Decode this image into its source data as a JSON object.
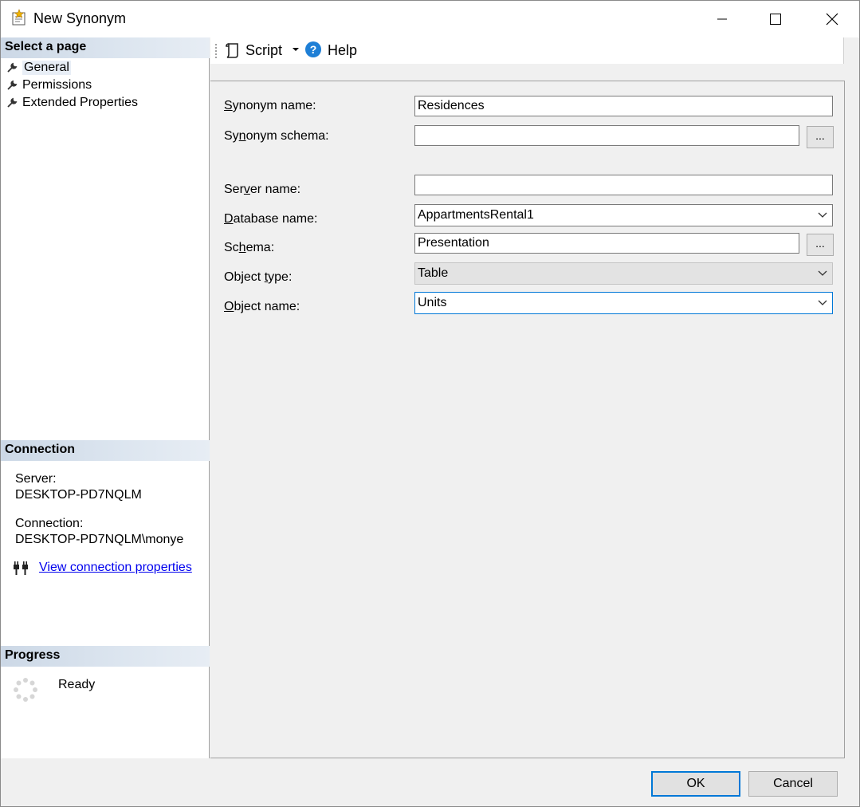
{
  "window": {
    "title": "New Synonym"
  },
  "left_pane": {
    "select_page_header": "Select a page",
    "pages": [
      {
        "label": "General"
      },
      {
        "label": "Permissions"
      },
      {
        "label": "Extended Properties"
      }
    ],
    "connection_header": "Connection",
    "server_label": "Server:",
    "server_value": "DESKTOP-PD7NQLM",
    "connection_label": "Connection:",
    "connection_value": "DESKTOP-PD7NQLM\\monye",
    "view_connection_link": "View connection properties",
    "progress_header": "Progress",
    "progress_status": "Ready"
  },
  "toolbar": {
    "script_label": "Script",
    "help_label": "Help"
  },
  "form": {
    "synonym_name": {
      "label_pre": "",
      "label_u": "S",
      "label_post": "ynonym name:",
      "value": "Residences"
    },
    "synonym_schema": {
      "label_pre": "Sy",
      "label_u": "n",
      "label_post": "onym schema:",
      "value": "",
      "browse": "..."
    },
    "server_name": {
      "label_pre": "Ser",
      "label_u": "v",
      "label_post": "er name:",
      "value": ""
    },
    "database_name": {
      "label_pre": "",
      "label_u": "D",
      "label_post": "atabase name:",
      "value": "AppartmentsRental1"
    },
    "schema": {
      "label_pre": "Sc",
      "label_u": "h",
      "label_post": "ema:",
      "value": "Presentation",
      "browse": "..."
    },
    "object_type": {
      "label_pre": "Object ",
      "label_u": "t",
      "label_post": "ype:",
      "value": "Table"
    },
    "object_name": {
      "label_pre": "",
      "label_u": "O",
      "label_post": "bject name:",
      "value": "Units"
    }
  },
  "buttons": {
    "ok": "OK",
    "cancel": "Cancel"
  },
  "colors": {
    "accent": "#0078d7",
    "section_header": "#ccd8e6",
    "link": "#0000ee"
  }
}
